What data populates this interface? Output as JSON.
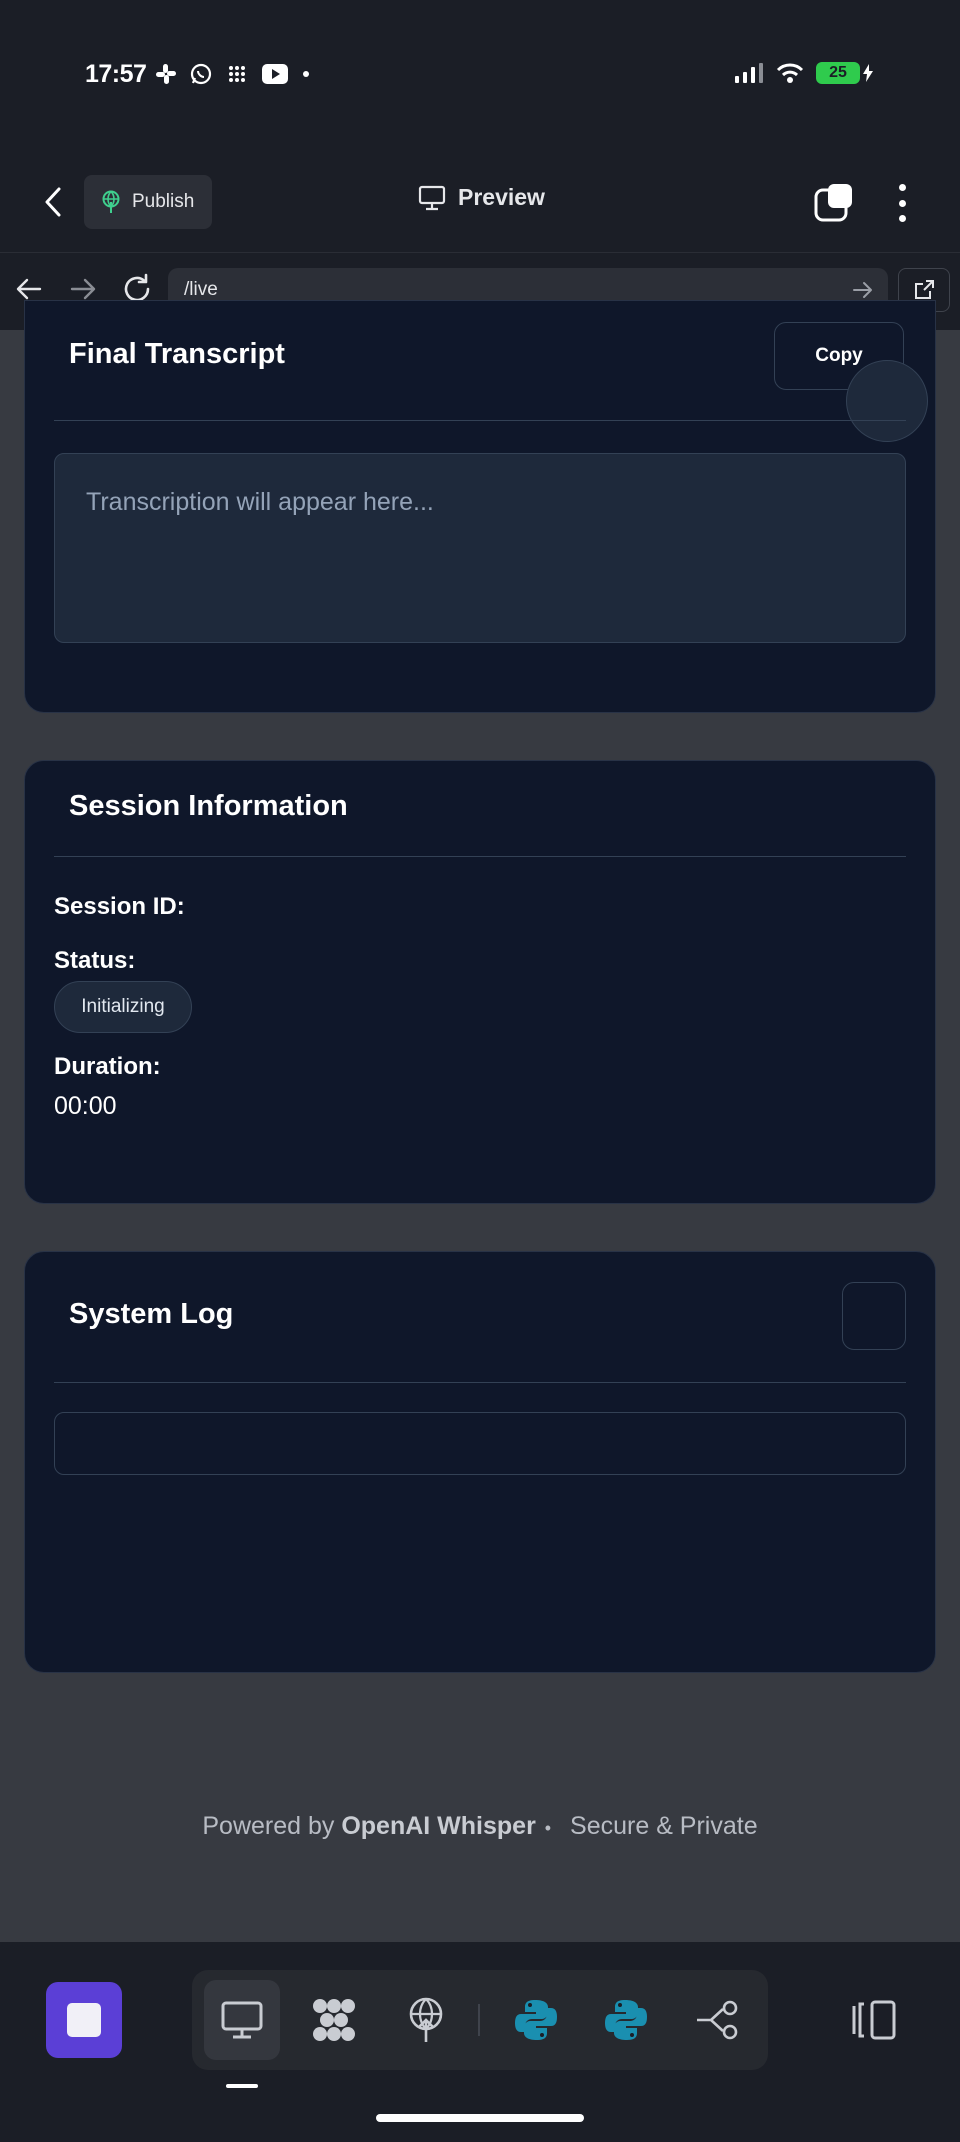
{
  "status_bar": {
    "time": "17:57",
    "battery": "25"
  },
  "header": {
    "publish_label": "Publish",
    "preview_label": "Preview"
  },
  "browser": {
    "url": "/live"
  },
  "transcript_card": {
    "title": "Final Transcript",
    "copy_label": "Copy",
    "placeholder": "Transcription will appear here..."
  },
  "session_card": {
    "title": "Session Information",
    "session_id_label": "Session ID:",
    "status_label": "Status:",
    "status_value": "Initializing",
    "duration_label": "Duration:",
    "duration_value": "00:00"
  },
  "log_card": {
    "title": "System Log"
  },
  "footer": {
    "prefix": "Powered by",
    "brand": "OpenAI Whisper",
    "separator": "•",
    "suffix": "Secure & Private"
  },
  "colors": {
    "accent": "#5b3fd6",
    "card_bg": "#0f172a",
    "page_bg": "#373a41",
    "battery": "#2fcb4d"
  }
}
